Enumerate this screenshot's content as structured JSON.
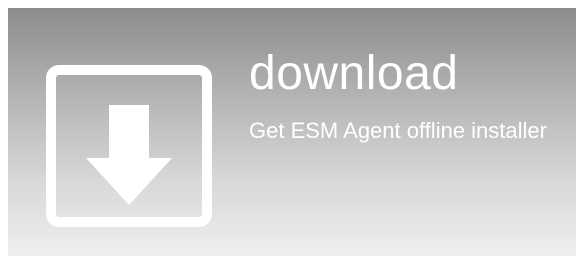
{
  "tile": {
    "title": "download",
    "description": "Get ESM Agent offline installer",
    "icon": "download-arrow-icon",
    "colors": {
      "gradient_top": "#8c8c8c",
      "gradient_bottom": "#efefef",
      "foreground": "#ffffff"
    }
  }
}
